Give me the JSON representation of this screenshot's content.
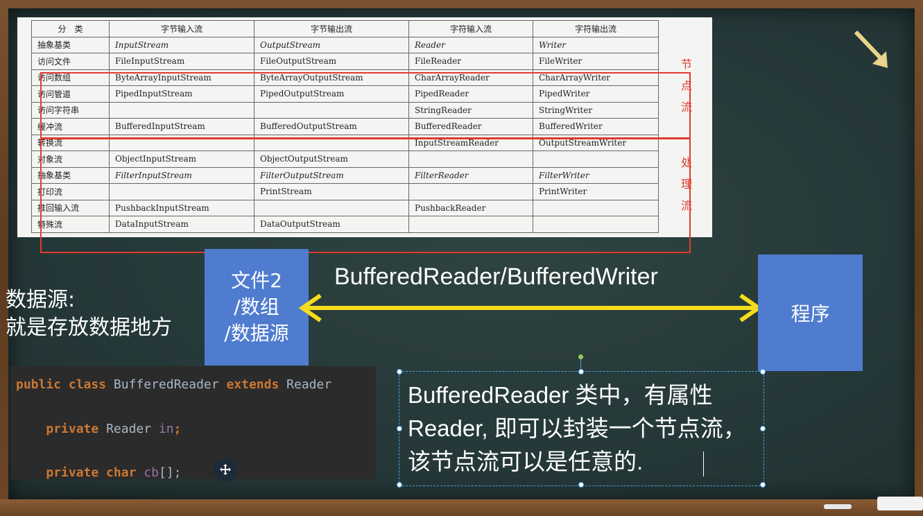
{
  "table": {
    "headers": [
      "分　类",
      "字节输入流",
      "字节输出流",
      "字符输入流",
      "字符输出流"
    ],
    "rows": [
      [
        "抽象基类",
        "InputStream",
        "OutputStream",
        "Reader",
        "Writer"
      ],
      [
        "访问文件",
        "FileInputStream",
        "FileOutputStream",
        "FileReader",
        "FileWriter"
      ],
      [
        "访问数组",
        "ByteArrayInputStream",
        "ByteArrayOutputStream",
        "CharArrayReader",
        "CharArrayWriter"
      ],
      [
        "访问管道",
        "PipedInputStream",
        "PipedOutputStream",
        "PipedReader",
        "PipedWriter"
      ],
      [
        "访问字符串",
        "",
        "",
        "StringReader",
        "StringWriter"
      ],
      [
        "缓冲流",
        "BufferedInputStream",
        "BufferedOutputStream",
        "BufferedReader",
        "BufferedWriter"
      ],
      [
        "转换流",
        "",
        "",
        "InputStreamReader",
        "OutputStreamWriter"
      ],
      [
        "对象流",
        "ObjectInputStream",
        "ObjectOutputStream",
        "",
        ""
      ],
      [
        "抽象基类",
        "FilterInputStream",
        "FilterOutputStream",
        "FilterReader",
        "FilterWriter"
      ],
      [
        "打印流",
        "",
        "PrintStream",
        "",
        "PrintWriter"
      ],
      [
        "推回输入流",
        "PushbackInputStream",
        "",
        "PushbackReader",
        ""
      ],
      [
        "特殊流",
        "DataInputStream",
        "DataOutputStream",
        "",
        ""
      ]
    ],
    "node_label": [
      "节",
      "点",
      "流"
    ],
    "proc_label": [
      "处",
      "理",
      "流"
    ]
  },
  "diagram": {
    "source_line1": "数据源:",
    "source_line2": "就是存放数据地方",
    "file_box": [
      "文件2",
      "/数组",
      "/数据源"
    ],
    "arrow_label": "BufferedReader/BufferedWriter",
    "program": "程序"
  },
  "code": {
    "line1": {
      "kw1": "public class ",
      "name": "BufferedReader ",
      "kw2": "extends ",
      "parent": "Reader "
    },
    "line2": {
      "kw": "private ",
      "type": "Reader ",
      "field": "in",
      "end": ";"
    },
    "line3": {
      "kw": "private char ",
      "field": "cb",
      "end": "[];"
    }
  },
  "note": {
    "text": "BufferedReader 类中，有属性Reader, 即可以封装一个节点流，该节点流可以是任意的."
  },
  "colors": {
    "accent_red": "#e03b2e",
    "box_blue": "#4f7ccf",
    "arrow_yellow": "#f5dc1c"
  }
}
